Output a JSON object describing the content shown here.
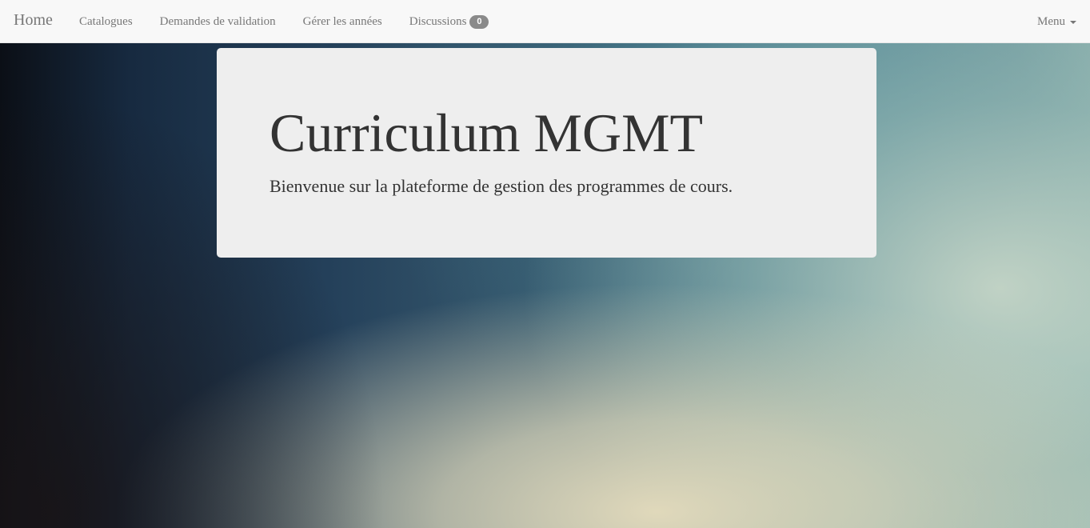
{
  "navbar": {
    "brand": "Home",
    "links": [
      {
        "label": "Catalogues"
      },
      {
        "label": "Demandes de validation"
      },
      {
        "label": "Gérer les années"
      },
      {
        "label": "Discussions"
      }
    ],
    "discussions_badge": "0",
    "menu_label": "Menu",
    "menu_icon": "caret-down-icon"
  },
  "jumbotron": {
    "title": "Curriculum MGMT",
    "lead": "Bienvenue sur la plateforme de gestion des programmes de cours."
  },
  "colors": {
    "navbar_bg": "#f8f8f8",
    "navbar_text": "#777777",
    "jumbotron_bg": "#eeeeee",
    "text": "#333333",
    "badge_bg": "#8a8a8a"
  }
}
